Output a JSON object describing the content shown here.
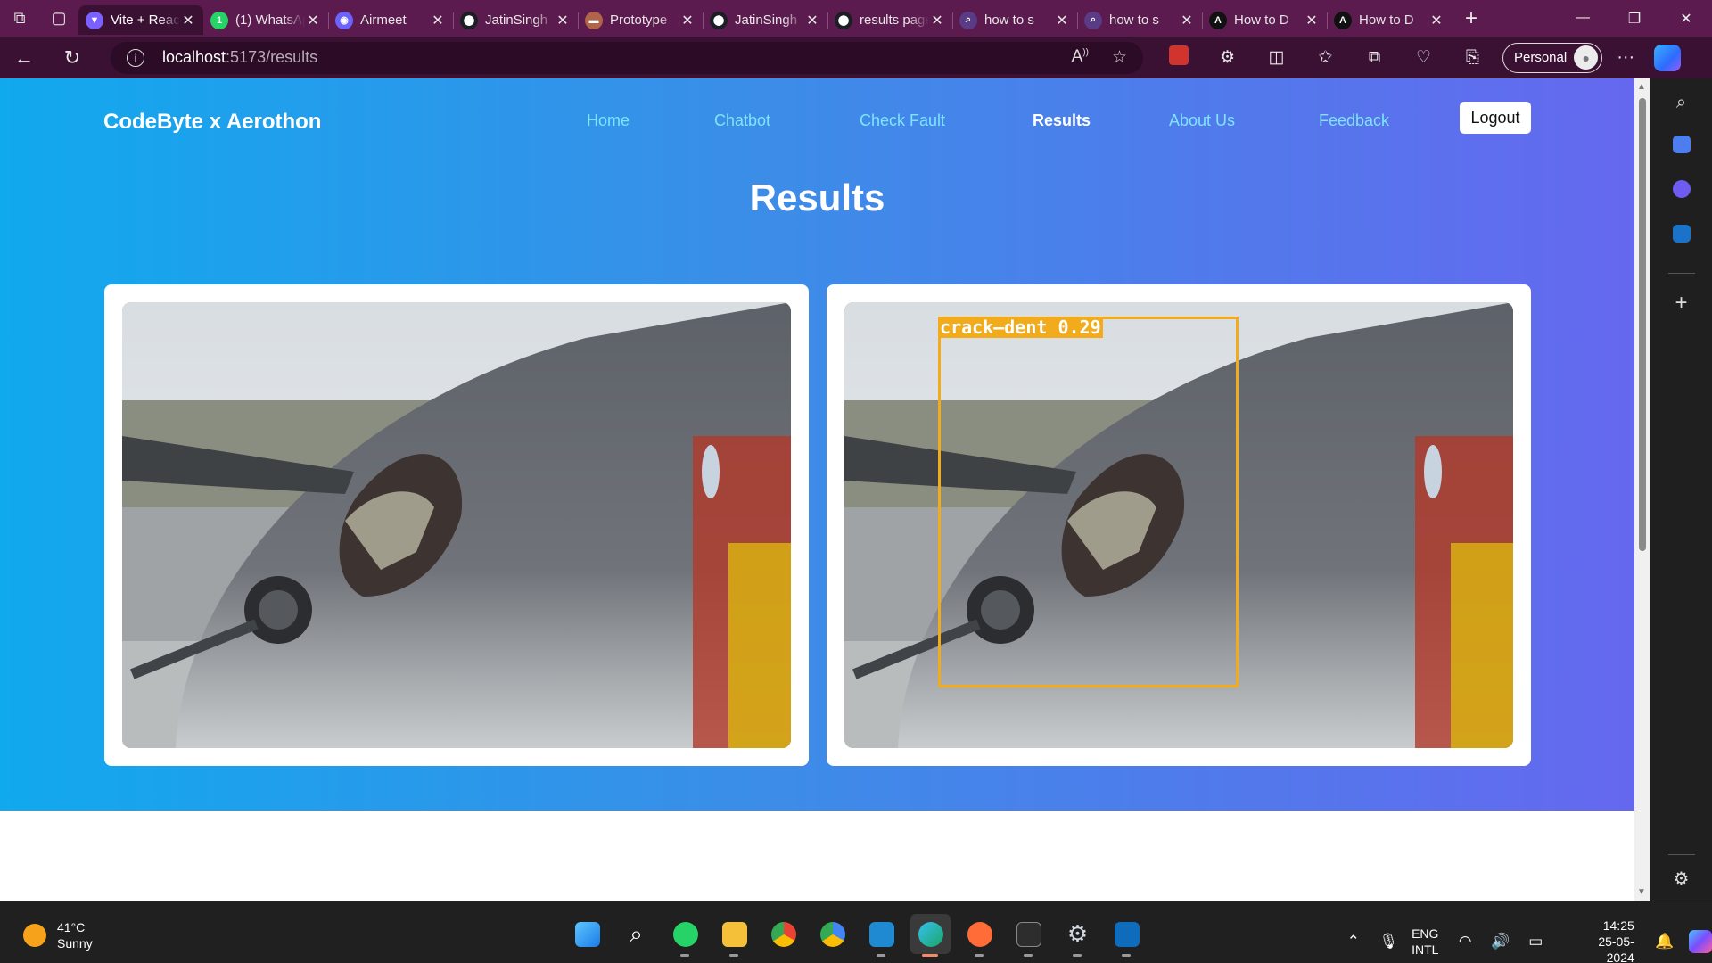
{
  "browser": {
    "tabs": [
      {
        "title": "Vite + React",
        "favicon": "vite-icon",
        "color": "#7b61ff",
        "glyph": "▼",
        "active": true
      },
      {
        "title": "(1) WhatsApp",
        "favicon": "whatsapp-icon",
        "color": "#25d366",
        "glyph": "1"
      },
      {
        "title": "Airmeet",
        "favicon": "airmeet-icon",
        "color": "#6c63ff",
        "glyph": "◉"
      },
      {
        "title": "JatinSingh",
        "favicon": "github-icon",
        "color": "#1b1f23",
        "glyph": "⬤"
      },
      {
        "title": "Prototype",
        "favicon": "prototype-icon",
        "color": "#b0644a",
        "glyph": "▬"
      },
      {
        "title": "JatinSingh",
        "favicon": "github-icon",
        "color": "#1b1f23",
        "glyph": "⬤"
      },
      {
        "title": "results page",
        "favicon": "github-icon",
        "color": "#1b1f23",
        "glyph": "⬤"
      },
      {
        "title": "how to s",
        "favicon": "search-icon",
        "color": "#5a3b86",
        "glyph": "⌕"
      },
      {
        "title": "how to s",
        "favicon": "search-icon",
        "color": "#5a3b86",
        "glyph": "⌕"
      },
      {
        "title": "How to D",
        "favicon": "angular-icon",
        "color": "#111111",
        "glyph": "A"
      },
      {
        "title": "How to D",
        "favicon": "angular-icon",
        "color": "#111111",
        "glyph": "A"
      }
    ],
    "url_host": "localhost",
    "url_path": ":5173/results",
    "profile_label": "Personal"
  },
  "site": {
    "brand": "CodeByte x Aerothon",
    "nav": [
      {
        "label": "Home"
      },
      {
        "label": "Chatbot"
      },
      {
        "label": "Check Fault"
      },
      {
        "label": "Results",
        "current": true
      },
      {
        "label": "About Us"
      },
      {
        "label": "Feedback"
      }
    ],
    "logout_label": "Logout",
    "page_title": "Results",
    "detection": {
      "label": "crack–dent 0.29",
      "color": "#f2ac1b"
    }
  },
  "taskbar": {
    "temperature": "41°C",
    "condition": "Sunny",
    "lang_top": "ENG",
    "lang_bottom": "INTL",
    "time": "14:25",
    "date": "25-05-2024"
  },
  "colors": {
    "hero_gradient_start": "#11a9ee",
    "hero_gradient_end": "#6568ef",
    "nav_link": "#7fe4f7",
    "tab_bar": "#5c1b4e",
    "address_bar": "#3a1033"
  }
}
